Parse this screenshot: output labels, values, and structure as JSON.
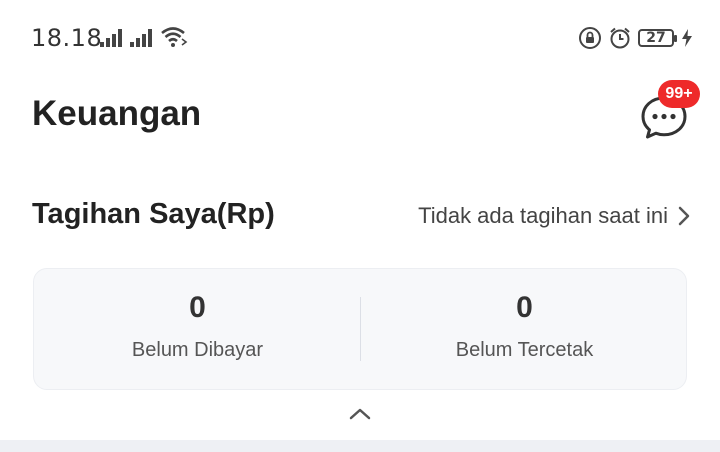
{
  "status_bar": {
    "time": "18.18",
    "battery_level": "27"
  },
  "header": {
    "title": "Keuangan",
    "chat_badge": "99+"
  },
  "bills": {
    "title": "Tagihan Saya(Rp)",
    "status_text": "Tidak ada tagihan saat ini",
    "stats": [
      {
        "value": "0",
        "label": "Belum Dibayar"
      },
      {
        "value": "0",
        "label": "Belum Tercetak"
      }
    ]
  },
  "colors": {
    "badge": "#ee2a2a",
    "card_bg": "#f7f8fa"
  },
  "icons": [
    "signal-icon",
    "wifi-icon",
    "lock-rotation-icon",
    "alarm-icon",
    "battery-icon",
    "charging-icon",
    "chat-icon",
    "chevron-right-icon",
    "chevron-up-icon"
  ]
}
